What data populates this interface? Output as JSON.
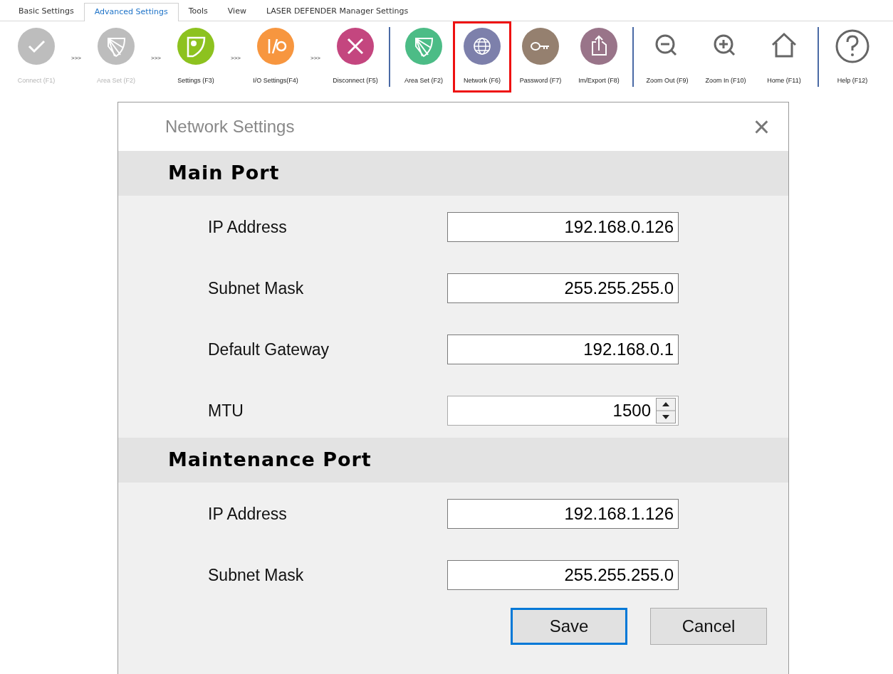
{
  "tabs": [
    {
      "label": "Basic Settings",
      "selected": false
    },
    {
      "label": "Advanced Settings",
      "selected": true
    },
    {
      "label": "Tools",
      "selected": false
    },
    {
      "label": "View",
      "selected": false
    },
    {
      "label": "LASER DEFENDER Manager Settings",
      "selected": false
    }
  ],
  "toolbar": {
    "groups": [
      {
        "items": [
          {
            "kind": "button",
            "color": "#bdbdbd",
            "label": "Connect (F1)",
            "disabled": true,
            "selected": false
          },
          {
            "kind": "arrow",
            "text": ">>>"
          },
          {
            "kind": "button",
            "color": "#bdbdbd",
            "label": "Area Set (F2)",
            "disabled": true,
            "selected": false
          },
          {
            "kind": "arrow",
            "text": ">>>"
          },
          {
            "kind": "button",
            "color": "#8dc21f",
            "label": "Settings (F3)",
            "disabled": false,
            "selected": false
          },
          {
            "kind": "arrow",
            "text": ">>>"
          },
          {
            "kind": "button",
            "color": "#f7963f",
            "label": "I/O Settings(F4)",
            "disabled": false,
            "selected": false
          },
          {
            "kind": "arrow",
            "text": ">>>"
          },
          {
            "kind": "button",
            "color": "#c4467f",
            "label": "Disconnect (F5)",
            "disabled": false,
            "selected": false
          }
        ]
      },
      {
        "items": [
          {
            "kind": "button",
            "color": "#4cbc86",
            "label": "Area Set (F2)",
            "disabled": false,
            "selected": false
          },
          {
            "kind": "button",
            "color": "#7d80ab",
            "label": "Network (F6)",
            "disabled": false,
            "selected": true
          },
          {
            "kind": "button",
            "color": "#95806f",
            "label": "Password (F7)",
            "disabled": false,
            "selected": false
          },
          {
            "kind": "button",
            "color": "#997489",
            "label": "Im/Export (F8)",
            "disabled": false,
            "selected": false
          }
        ]
      },
      {
        "items": [
          {
            "kind": "button",
            "label": "Zoom Out (F9)",
            "disabled": false,
            "selected": false
          },
          {
            "kind": "button",
            "label": "Zoom In (F10)",
            "disabled": false,
            "selected": false
          },
          {
            "kind": "button",
            "label": "Home (F11)",
            "disabled": false,
            "selected": false
          }
        ]
      },
      {
        "items": [
          {
            "kind": "button",
            "label": "Help (F12)",
            "disabled": false,
            "selected": false
          }
        ]
      }
    ]
  },
  "dialog": {
    "title": "Network Settings",
    "close": "×",
    "sections": [
      {
        "title": "Main Port",
        "fields": [
          {
            "kind": "text",
            "label": "IP Address",
            "value": "192.168.0.126"
          },
          {
            "kind": "text",
            "label": "Subnet Mask",
            "value": "255.255.255.0"
          },
          {
            "kind": "text",
            "label": "Default Gateway",
            "value": "192.168.0.1"
          },
          {
            "kind": "spinner",
            "label": "MTU",
            "value": "1500"
          }
        ]
      },
      {
        "title": "Maintenance Port",
        "fields": [
          {
            "kind": "text",
            "label": "IP Address",
            "value": "192.168.1.126"
          },
          {
            "kind": "text",
            "label": "Subnet Mask",
            "value": "255.255.255.0"
          }
        ]
      }
    ],
    "buttons": [
      {
        "label": "Save",
        "default": true
      },
      {
        "label": "Cancel",
        "default": false
      }
    ]
  }
}
